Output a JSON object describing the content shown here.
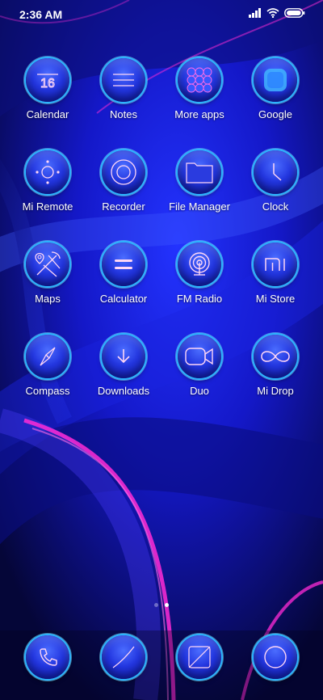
{
  "status_bar": {
    "time": "2:36 AM",
    "icons": [
      "signal-icon",
      "wifi-icon",
      "battery-icon"
    ]
  },
  "apps": [
    {
      "label": "Calendar",
      "icon": "calendar-icon",
      "icon_text": "16"
    },
    {
      "label": "Notes",
      "icon": "notes-icon"
    },
    {
      "label": "More apps",
      "icon": "app-folder-icon"
    },
    {
      "label": "Google",
      "icon": "google-icon"
    },
    {
      "label": "Mi Remote",
      "icon": "remote-icon"
    },
    {
      "label": "Recorder",
      "icon": "recorder-icon"
    },
    {
      "label": "File Manager",
      "icon": "folder-icon"
    },
    {
      "label": "Clock",
      "icon": "clock-icon"
    },
    {
      "label": "Maps",
      "icon": "maps-icon"
    },
    {
      "label": "Calculator",
      "icon": "calculator-icon"
    },
    {
      "label": "FM Radio",
      "icon": "radio-icon"
    },
    {
      "label": "Mi Store",
      "icon": "mi-store-icon",
      "icon_text": "mi"
    },
    {
      "label": "Compass",
      "icon": "compass-icon"
    },
    {
      "label": "Downloads",
      "icon": "download-icon"
    },
    {
      "label": "Duo",
      "icon": "video-camera-icon"
    },
    {
      "label": "Mi Drop",
      "icon": "infinity-icon"
    }
  ],
  "dock": [
    {
      "icon": "phone-icon"
    },
    {
      "icon": "messages-icon"
    },
    {
      "icon": "browser-icon"
    },
    {
      "icon": "camera-icon"
    }
  ],
  "page_indicator": {
    "pages": 2,
    "active": 2
  },
  "colors": {
    "wallpaper_base": "#05063a",
    "wallpaper_blue": "#1f2bff",
    "wallpaper_magenta": "#ff2bd6",
    "icon_ring": "#2bb4ff"
  }
}
